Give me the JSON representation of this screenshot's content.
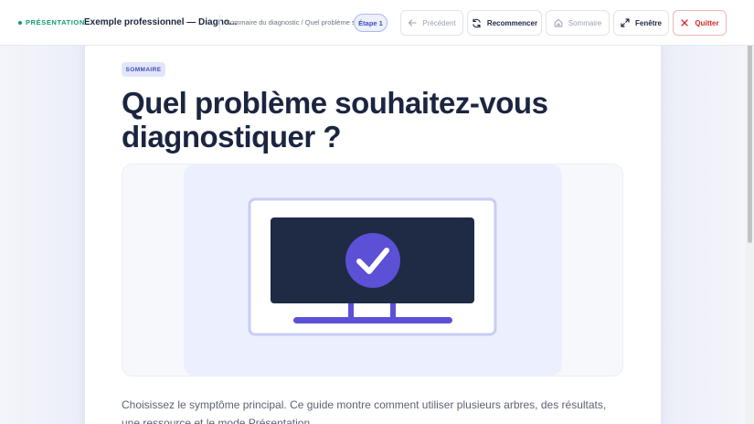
{
  "topbar": {
    "mode_label": "PRÉSENTATION",
    "doc_title": "Exemple professionnel — Diagno...",
    "breadcrumb": "Sommaire du diagnostic / Quel problème s...",
    "step_label": "Étape 1",
    "buttons": {
      "previous": "Précédent",
      "restart": "Recommencer",
      "summary": "Sommaire",
      "window": "Fenêtre",
      "quit": "Quitter"
    }
  },
  "content": {
    "badge": "SOMMAIRE",
    "headline": "Quel problème souhaitez-vous diagnostiquer ?",
    "description": "Choisissez le symptôme principal. Ce guide montre comment utiliser plusieurs arbres, des résultats, une ressource et le mode Présentation."
  },
  "icons": [
    "arrow-left-icon",
    "refresh-icon",
    "home-icon",
    "expand-icon",
    "close-icon",
    "check-icon",
    "monitor-icon"
  ],
  "colors": {
    "accent": "#5b50d6",
    "mode_green": "#0f9d6a",
    "quit_red": "#d42a2a",
    "screen_dark": "#1f2a44"
  }
}
